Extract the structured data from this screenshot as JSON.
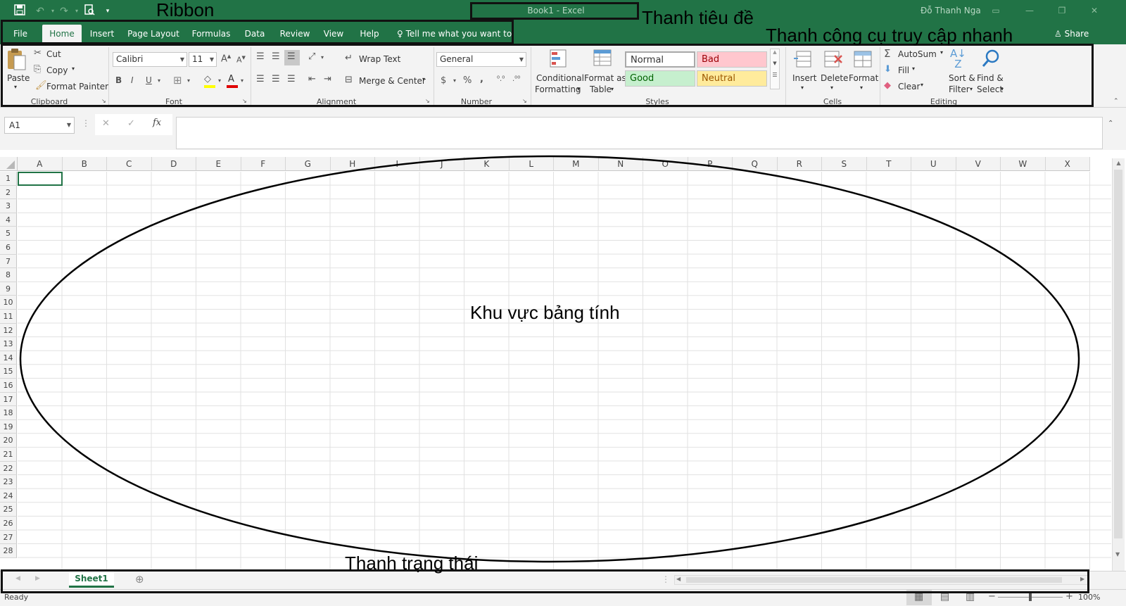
{
  "title_bar": {
    "window_title": "Book1  -  Excel",
    "user_name": "Đỗ Thanh Nga",
    "share_label": "Share"
  },
  "tabs": [
    "File",
    "Home",
    "Insert",
    "Page Layout",
    "Formulas",
    "Data",
    "Review",
    "View",
    "Help"
  ],
  "tell_me": "Tell me what you want to do",
  "ribbon": {
    "clipboard": {
      "paste": "Paste",
      "cut": "Cut",
      "copy": "Copy",
      "format_painter": "Format Painter",
      "label": "Clipboard"
    },
    "font": {
      "font_name": "Calibri",
      "font_size": "11",
      "bold": "B",
      "italic": "I",
      "underline": "U",
      "label": "Font"
    },
    "alignment": {
      "wrap_text": "Wrap Text",
      "merge_center": "Merge & Center",
      "label": "Alignment"
    },
    "number": {
      "format": "General",
      "currency": "$",
      "percent": "%",
      "comma": ",",
      "label": "Number"
    },
    "styles": {
      "conditional_1": "Conditional",
      "conditional_2": "Formatting",
      "format_table_1": "Format as",
      "format_table_2": "Table",
      "normal": "Normal",
      "bad": "Bad",
      "good": "Good",
      "neutral": "Neutral",
      "label": "Styles"
    },
    "cells": {
      "insert": "Insert",
      "delete": "Delete",
      "format": "Format",
      "label": "Cells"
    },
    "editing": {
      "autosum": "AutoSum",
      "fill": "Fill",
      "clear": "Clear",
      "sort_1": "Sort &",
      "sort_2": "Filter",
      "find_1": "Find &",
      "find_2": "Select",
      "label": "Editing"
    }
  },
  "formula_bar": {
    "name_box": "A1",
    "fx": "fx",
    "cancel": "✕",
    "enter": "✓"
  },
  "columns": [
    "A",
    "B",
    "C",
    "D",
    "E",
    "F",
    "G",
    "H",
    "I",
    "J",
    "K",
    "L",
    "M",
    "N",
    "O",
    "P",
    "Q",
    "R",
    "S",
    "T",
    "U",
    "V",
    "W",
    "X"
  ],
  "rows": [
    "1",
    "2",
    "3",
    "4",
    "5",
    "6",
    "7",
    "8",
    "9",
    "10",
    "11",
    "12",
    "13",
    "14",
    "15",
    "16",
    "17",
    "18",
    "19",
    "20",
    "21",
    "22",
    "23",
    "24",
    "25",
    "26",
    "27",
    "28"
  ],
  "sheet_tab": "Sheet1",
  "status": {
    "ready": "Ready",
    "zoom": "100%"
  },
  "annotations": {
    "ribbon": "Ribbon",
    "title_bar": "Thanh tiêu đề",
    "quick_access": "Thanh công cụ truy cập nhanh",
    "worksheet_area": "Khu vực bảng tính",
    "status_bar": "Thanh trạng thái"
  },
  "colors": {
    "excel_green": "#217346",
    "bad_fill": "#ffc7ce",
    "good_fill": "#c6efce",
    "neutral_fill": "#ffeb9c"
  }
}
